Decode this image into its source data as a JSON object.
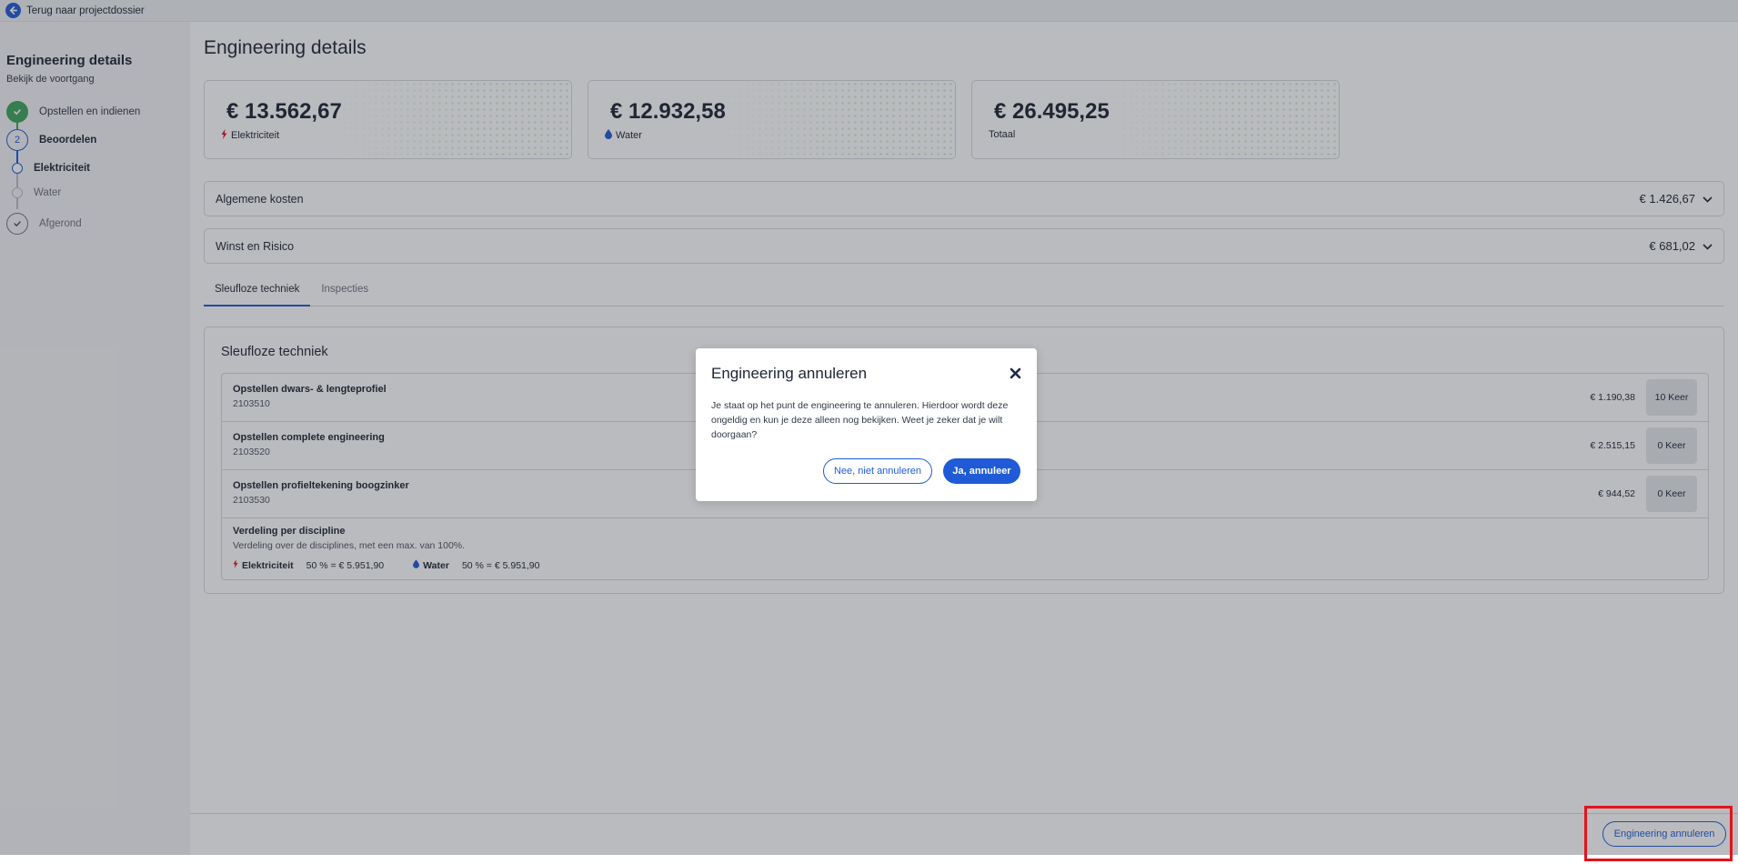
{
  "topbar": {
    "back_label": "Terug naar projectdossier",
    "icon": "arrow-left-circle-icon"
  },
  "sidebar": {
    "title": "Engineering details",
    "subtitle": "Bekijk de voortgang",
    "steps": [
      {
        "label": "Opstellen en indienen",
        "state": "done",
        "icon": "check-icon"
      },
      {
        "number": "2",
        "label": "Beoordelen",
        "state": "active"
      },
      {
        "label": "Elektriciteit",
        "state": "active-sub"
      },
      {
        "label": "Water",
        "state": "todo-sub"
      },
      {
        "label": "Afgerond",
        "state": "todo",
        "icon": "check-icon"
      }
    ]
  },
  "main": {
    "title": "Engineering details",
    "summary_cards": [
      {
        "amount": "€ 13.562,67",
        "label": "Elektriciteit",
        "icon": "bolt-icon",
        "icon_color": "#e3131b"
      },
      {
        "amount": "€ 12.932,58",
        "label": "Water",
        "icon": "water-drop-icon",
        "icon_color": "#1f5bd6"
      },
      {
        "amount": "€ 26.495,25",
        "label": "Totaal"
      }
    ],
    "accordions": [
      {
        "label": "Algemene kosten",
        "value": "€ 1.426,67",
        "icon": "chevron-down-icon"
      },
      {
        "label": "Winst en Risico",
        "value": "€ 681,02",
        "icon": "chevron-down-icon"
      }
    ],
    "tabs": [
      {
        "label": "Sleufloze techniek",
        "active": true
      },
      {
        "label": "Inspecties",
        "active": false
      }
    ],
    "panel": {
      "title": "Sleufloze techniek",
      "rows": [
        {
          "title": "Opstellen dwars- & lengteprofiel",
          "code": "2103510",
          "price": "€ 1.190,38",
          "qty": "10 Keer"
        },
        {
          "title": "Opstellen complete engineering",
          "code": "2103520",
          "price": "€ 2.515,15",
          "qty": "0 Keer"
        },
        {
          "title": "Opstellen profieltekening boogzinker",
          "code": "2103530",
          "price": "€ 944,52",
          "qty": "0 Keer"
        }
      ],
      "verdeling": {
        "title": "Verdeling per discipline",
        "subtitle": "Verdeling over de disciplines, met een max. van 100%.",
        "items": [
          {
            "label": "Elektriciteit",
            "value": "50 % = € 5.951,90",
            "icon": "bolt-icon"
          },
          {
            "label": "Water",
            "value": "50 % = € 5.951,90",
            "icon": "water-drop-icon"
          }
        ]
      }
    }
  },
  "footer": {
    "cancel_label": "Engineering annuleren"
  },
  "modal": {
    "title": "Engineering annuleren",
    "close_icon": "close-icon",
    "body": "Je staat op het punt de engineering te annuleren. Hierdoor wordt deze ongeldig en kun je deze alleen nog bekijken. Weet je zeker dat je wilt doorgaan?",
    "no_label": "Nee, niet annuleren",
    "yes_label": "Ja, annuleer"
  },
  "colors": {
    "primary": "#1f5bd6",
    "success": "#3fa45b",
    "danger": "#e3131b",
    "highlight": "#e3131b"
  }
}
